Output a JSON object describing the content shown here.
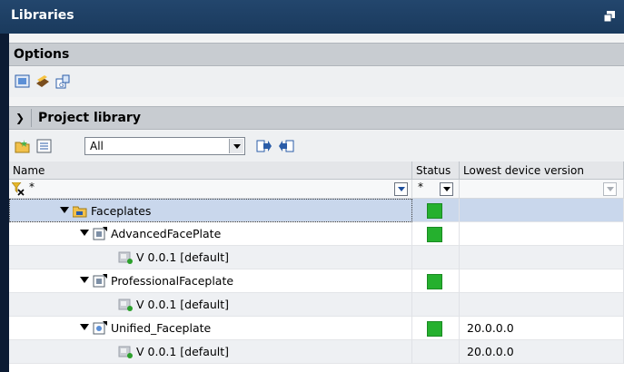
{
  "window": {
    "title": "Libraries"
  },
  "options": {
    "title": "Options",
    "toolbar": [
      "library-view-icon",
      "open-library-icon",
      "library-settings-icon"
    ]
  },
  "project_library": {
    "title": "Project library",
    "filter": {
      "selected": "All"
    },
    "toolbar_icons": [
      "add-folder-icon",
      "view-details-icon",
      "move-icon",
      "import-icon"
    ]
  },
  "table": {
    "columns": [
      "Name",
      "Status",
      "Lowest device version"
    ],
    "filter_row": {
      "name": "*",
      "status": "*"
    },
    "rows": [
      {
        "name": "Faceplates",
        "status": "ok",
        "version": ""
      },
      {
        "name": "AdvancedFacePlate",
        "status": "ok",
        "version": ""
      },
      {
        "name": "V 0.0.1 [default]",
        "status": "",
        "version": ""
      },
      {
        "name": "ProfessionalFaceplate",
        "status": "ok",
        "version": ""
      },
      {
        "name": "V 0.0.1 [default]",
        "status": "",
        "version": ""
      },
      {
        "name": "Unified_Faceplate",
        "status": "ok",
        "version": "20.0.0.0"
      },
      {
        "name": "V 0.0.1 [default]",
        "status": "",
        "version": "20.0.0.0"
      }
    ]
  },
  "colors": {
    "titlebar": "#1a3a5d",
    "status_ok": "#25b02e",
    "selection": "#c9d7ec"
  }
}
